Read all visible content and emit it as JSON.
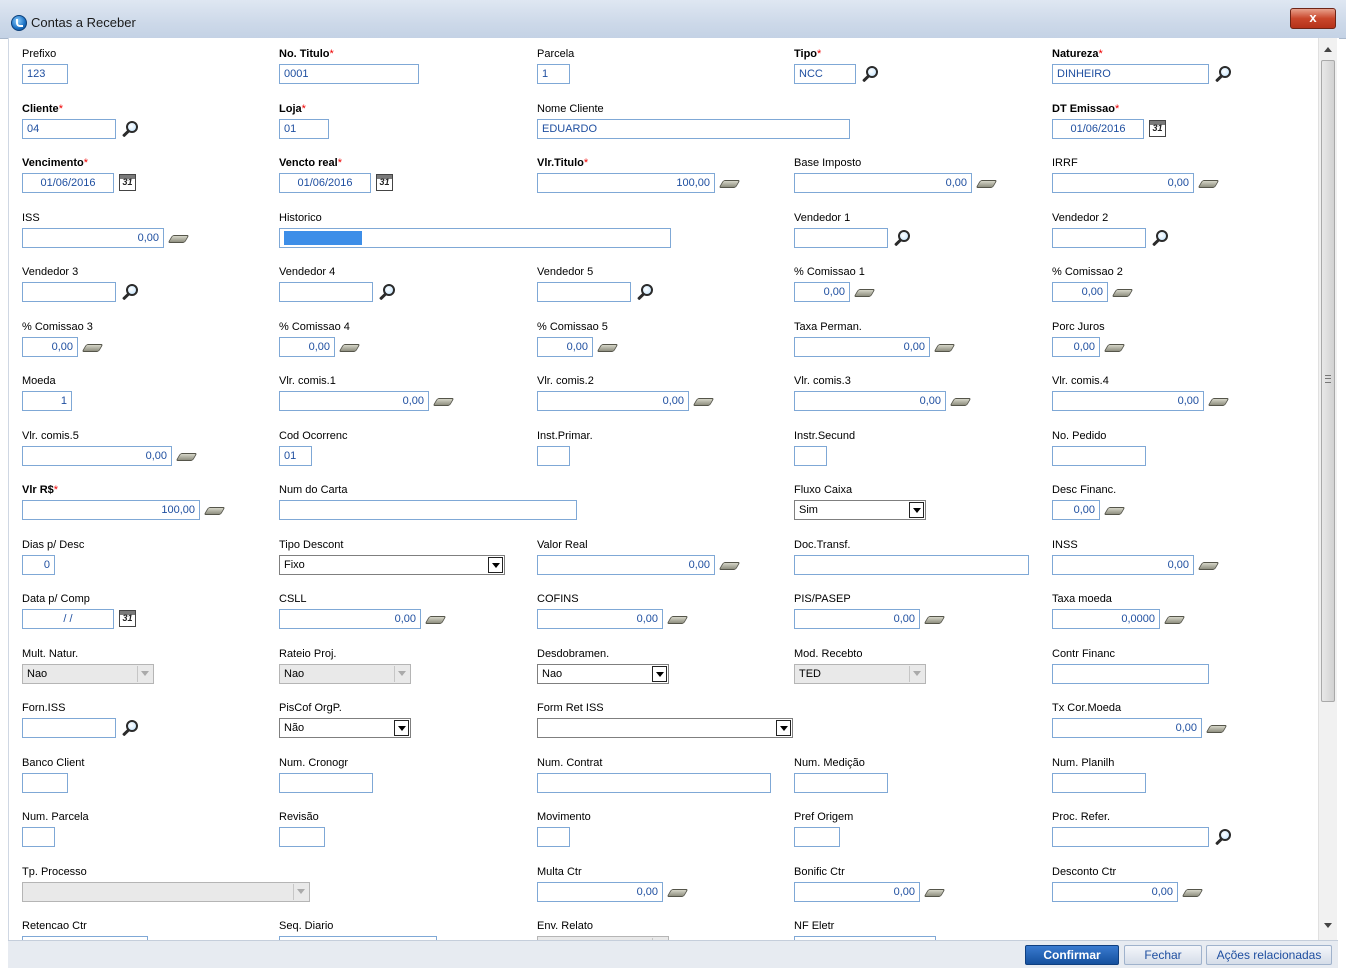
{
  "window": {
    "title": "Contas a Receber",
    "close_label": "x"
  },
  "footer": {
    "confirm": "Confirmar",
    "close": "Fechar",
    "actions": "Ações relacionadas"
  },
  "form": {
    "prefixo": {
      "label": "Prefixo",
      "value": "123"
    },
    "no_titulo": {
      "label": "No. Titulo",
      "value": "0001"
    },
    "parcela": {
      "label": "Parcela",
      "value": "1"
    },
    "tipo": {
      "label": "Tipo",
      "value": "NCC"
    },
    "natureza": {
      "label": "Natureza",
      "value": "DINHEIRO"
    },
    "cliente": {
      "label": "Cliente",
      "value": "04"
    },
    "loja": {
      "label": "Loja",
      "value": "01"
    },
    "nome_cliente": {
      "label": "Nome Cliente",
      "value": "EDUARDO"
    },
    "dt_emissao": {
      "label": "DT Emissao",
      "value": "01/06/2016"
    },
    "vencimento": {
      "label": "Vencimento",
      "value": "01/06/2016"
    },
    "vencto_real": {
      "label": "Vencto real",
      "value": "01/06/2016"
    },
    "vlr_titulo": {
      "label": "Vlr.Titulo",
      "value": "100,00"
    },
    "base_imposto": {
      "label": "Base Imposto",
      "value": "0,00"
    },
    "irrf": {
      "label": "IRRF",
      "value": "0,00"
    },
    "iss": {
      "label": "ISS",
      "value": "0,00"
    },
    "historico": {
      "label": "Historico",
      "value": ""
    },
    "vendedor1": {
      "label": "Vendedor 1",
      "value": ""
    },
    "vendedor2": {
      "label": "Vendedor 2",
      "value": ""
    },
    "vendedor3": {
      "label": "Vendedor 3",
      "value": ""
    },
    "vendedor4": {
      "label": "Vendedor 4",
      "value": ""
    },
    "vendedor5": {
      "label": "Vendedor 5",
      "value": ""
    },
    "comissao1": {
      "label": "% Comissao 1",
      "value": "0,00"
    },
    "comissao2": {
      "label": "% Comissao 2",
      "value": "0,00"
    },
    "comissao3": {
      "label": "% Comissao 3",
      "value": "0,00"
    },
    "comissao4": {
      "label": "% Comissao 4",
      "value": "0,00"
    },
    "comissao5": {
      "label": "% Comissao 5",
      "value": "0,00"
    },
    "taxa_perman": {
      "label": "Taxa Perman.",
      "value": "0,00"
    },
    "porc_juros": {
      "label": "Porc Juros",
      "value": "0,00"
    },
    "moeda": {
      "label": "Moeda",
      "value": "1"
    },
    "vlr_comis1": {
      "label": "Vlr. comis.1",
      "value": "0,00"
    },
    "vlr_comis2": {
      "label": "Vlr. comis.2",
      "value": "0,00"
    },
    "vlr_comis3": {
      "label": "Vlr. comis.3",
      "value": "0,00"
    },
    "vlr_comis4": {
      "label": "Vlr. comis.4",
      "value": "0,00"
    },
    "vlr_comis5": {
      "label": "Vlr. comis.5",
      "value": "0,00"
    },
    "cod_ocorrenc": {
      "label": "Cod Ocorrenc",
      "value": "01"
    },
    "inst_primar": {
      "label": "Inst.Primar.",
      "value": ""
    },
    "instr_secund": {
      "label": "Instr.Secund",
      "value": ""
    },
    "no_pedido": {
      "label": "No. Pedido",
      "value": ""
    },
    "vlr_rs": {
      "label": "Vlr R$",
      "value": "100,00"
    },
    "num_carta": {
      "label": "Num do Carta",
      "value": ""
    },
    "fluxo_caixa": {
      "label": "Fluxo Caixa",
      "value": "Sim"
    },
    "desc_financ": {
      "label": "Desc Financ.",
      "value": "0,00"
    },
    "dias_desc": {
      "label": "Dias p/ Desc",
      "value": "0"
    },
    "tipo_descont": {
      "label": "Tipo Descont",
      "value": "Fixo"
    },
    "valor_real": {
      "label": "Valor Real",
      "value": "0,00"
    },
    "doc_transf": {
      "label": "Doc.Transf.",
      "value": ""
    },
    "inss": {
      "label": "INSS",
      "value": "0,00"
    },
    "data_comp": {
      "label": "Data p/ Comp",
      "value": "/ /"
    },
    "csll": {
      "label": "CSLL",
      "value": "0,00"
    },
    "cofins": {
      "label": "COFINS",
      "value": "0,00"
    },
    "pis_pasep": {
      "label": "PIS/PASEP",
      "value": "0,00"
    },
    "taxa_moeda": {
      "label": "Taxa moeda",
      "value": "0,0000"
    },
    "mult_natur": {
      "label": "Mult. Natur.",
      "value": "Nao"
    },
    "rateio_proj": {
      "label": "Rateio Proj.",
      "value": "Nao"
    },
    "desdobramen": {
      "label": "Desdobramen.",
      "value": "Nao"
    },
    "mod_recebto": {
      "label": "Mod. Recebto",
      "value": "TED"
    },
    "contr_financ": {
      "label": "Contr Financ",
      "value": ""
    },
    "forn_iss": {
      "label": "Forn.ISS",
      "value": ""
    },
    "piscof_orgp": {
      "label": "PisCof OrgP.",
      "value": "Não"
    },
    "form_ret_iss": {
      "label": "Form Ret ISS",
      "value": ""
    },
    "tx_cor_moeda": {
      "label": "Tx Cor.Moeda",
      "value": "0,00"
    },
    "banco_client": {
      "label": "Banco Client",
      "value": ""
    },
    "num_cronogr": {
      "label": "Num. Cronogr",
      "value": ""
    },
    "num_contrat": {
      "label": "Num. Contrat",
      "value": ""
    },
    "num_medicao": {
      "label": "Num. Medição",
      "value": ""
    },
    "num_planilh": {
      "label": "Num. Planilh",
      "value": ""
    },
    "num_parcela": {
      "label": "Num. Parcela",
      "value": ""
    },
    "revisao": {
      "label": "Revisão",
      "value": ""
    },
    "movimento": {
      "label": "Movimento",
      "value": ""
    },
    "pref_origem": {
      "label": "Pref Origem",
      "value": ""
    },
    "proc_refer": {
      "label": "Proc. Refer.",
      "value": ""
    },
    "tp_processo": {
      "label": "Tp. Processo",
      "value": ""
    },
    "multa_ctr": {
      "label": "Multa Ctr",
      "value": "0,00"
    },
    "bonific_ctr": {
      "label": "Bonific Ctr",
      "value": "0,00"
    },
    "desconto_ctr": {
      "label": "Desconto Ctr",
      "value": "0,00"
    },
    "retencao_ctr": {
      "label": "Retencao Ctr",
      "value": ""
    },
    "seq_diario": {
      "label": "Seq. Diario",
      "value": ""
    },
    "env_relato": {
      "label": "Env. Relato",
      "value": ""
    },
    "nf_eletr": {
      "label": "NF Eletr",
      "value": ""
    }
  },
  "required_marker": "*",
  "colors": {
    "title_bg": "#cdd9e9",
    "input_border": "#7fa8d6",
    "input_text": "#1f4fa0",
    "required": "#ee0000",
    "confirm_bg": "#15509e"
  }
}
